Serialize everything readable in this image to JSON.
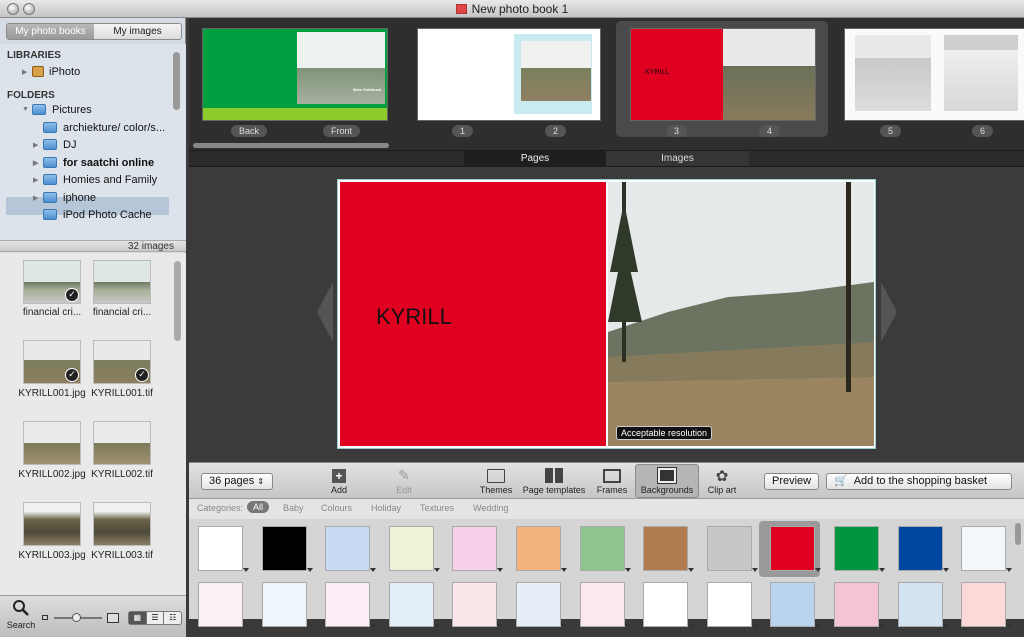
{
  "window": {
    "title": "New photo book 1"
  },
  "left_tabs": {
    "tab1": "My photo books",
    "tab2": "My images"
  },
  "sources": {
    "libraries_header": "LIBRARIES",
    "iphoto": "iPhoto",
    "folders_header": "FOLDERS",
    "folders": [
      "Pictures",
      "archiekture/ color/s...",
      "DJ",
      "for saatchi online",
      "Homies and Family",
      "iphone",
      "iPod Photo Cache"
    ]
  },
  "image_count": "32 images",
  "images": [
    {
      "name": "financial cri..."
    },
    {
      "name": "financial cri..."
    },
    {
      "name": "KYRILL001.jpg"
    },
    {
      "name": "KYRILL001.tif"
    },
    {
      "name": "KYRILL002.jpg"
    },
    {
      "name": "KYRILL002.tif"
    },
    {
      "name": "KYRILL003.jpg"
    },
    {
      "name": "KYRILL003.tif"
    }
  ],
  "bottom_left": {
    "search": "Search"
  },
  "page_strip": {
    "labels": [
      "Back",
      "Front",
      "1",
      "2",
      "3",
      "4",
      "5",
      "6"
    ],
    "cover_text": "Mein Fotobuch",
    "spread_text": "KYRILL"
  },
  "view_tabs": {
    "pages": "Pages",
    "images": "Images"
  },
  "page": {
    "title": "KYRILL",
    "badge": "Acceptable resolution",
    "red": "#e0001f"
  },
  "toolbar": {
    "pages_select": "36 pages",
    "add": "Add",
    "edit": "Edit",
    "themes": "Themes",
    "page_templates": "Page templates",
    "frames": "Frames",
    "backgrounds": "Backgrounds",
    "clip_art": "Clip art",
    "preview": "Preview",
    "basket": "Add to the shopping basket"
  },
  "categories": {
    "label": "Categories:",
    "items": [
      "All",
      "Baby",
      "Colours",
      "Holiday",
      "Textures",
      "Wedding"
    ],
    "selected": "All"
  },
  "swatch_colors_row1": [
    "#ffffff",
    "#000000",
    "#c7dcf3",
    "#eef3d8",
    "#f6cfe8",
    "#f4b27c",
    "#8ec58d",
    "#b07c50",
    "#c7c7c7",
    "#e0001f",
    "#009640",
    "#0047a0",
    "#f5f8fb"
  ],
  "swatch_colors_row2": [
    "#fbf0f6",
    "#eef5fb",
    "#fbeef6",
    "#e4eef8",
    "#fbe6ea",
    "#e6eef8",
    "#fbe8ee",
    "#ffffff",
    "#ffffff",
    "#b9d4ef",
    "#f4c3d4",
    "#d3e3f2",
    "#fbd9d9"
  ]
}
